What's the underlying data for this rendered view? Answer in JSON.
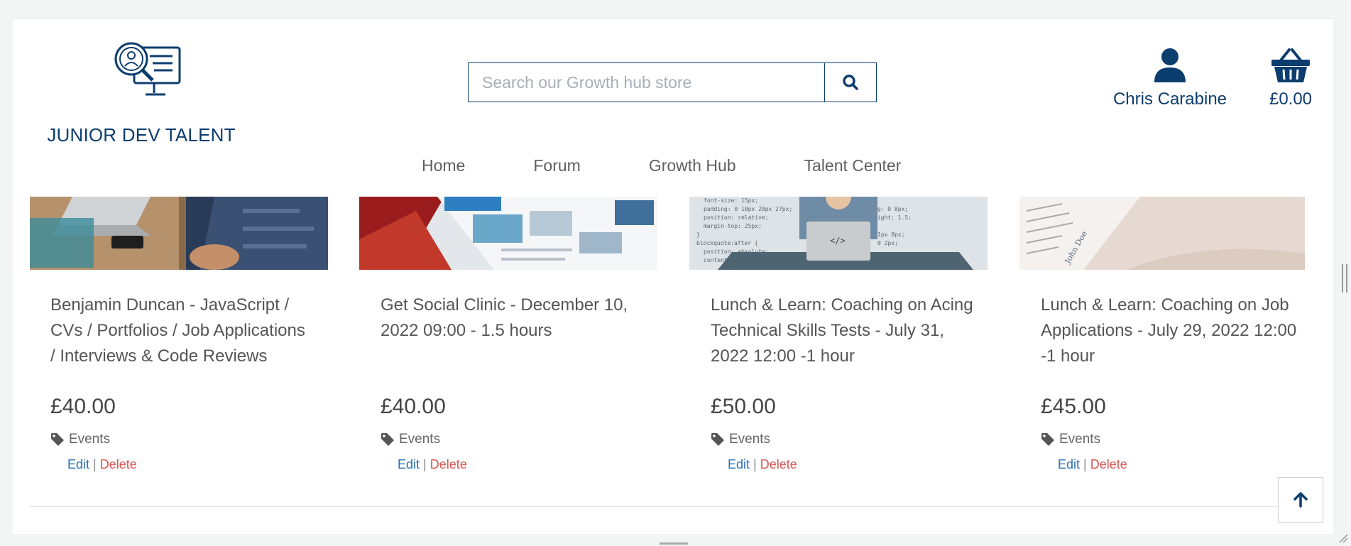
{
  "brand": {
    "name": "JUNIOR DEV TALENT",
    "color": "#0c3d6f"
  },
  "search": {
    "placeholder": "Search our Growth hub store"
  },
  "account": {
    "label": "Chris Carabine"
  },
  "cart": {
    "total": "£0.00"
  },
  "nav": {
    "items": [
      "Home",
      "Forum",
      "Growth Hub",
      "Talent Center"
    ]
  },
  "products": [
    {
      "title": "Benjamin Duncan - JavaScript / CVs / Portfolios / Job Applications / Interviews & Code Reviews",
      "price": "£40.00",
      "category": "Events",
      "edit": "Edit",
      "delete": "Delete"
    },
    {
      "title": "Get Social Clinic - December 10, 2022 09:00 - 1.5 hours",
      "price": "£40.00",
      "category": "Events",
      "edit": "Edit",
      "delete": "Delete"
    },
    {
      "title": "Lunch & Learn: Coaching on Acing Technical Skills Tests - July 31, 2022 12:00 -1 hour",
      "price": "£50.00",
      "category": "Events",
      "edit": "Edit",
      "delete": "Delete"
    },
    {
      "title": "Lunch & Learn: Coaching on Job Applications - July 29, 2022 12:00 -1 hour",
      "price": "£45.00",
      "category": "Events",
      "edit": "Edit",
      "delete": "Delete"
    }
  ],
  "separator": "|",
  "icons": {
    "search": "search-icon",
    "account": "user-icon",
    "cart": "basket-icon",
    "tag": "tag-icon",
    "to_top": "arrow-up-icon"
  }
}
